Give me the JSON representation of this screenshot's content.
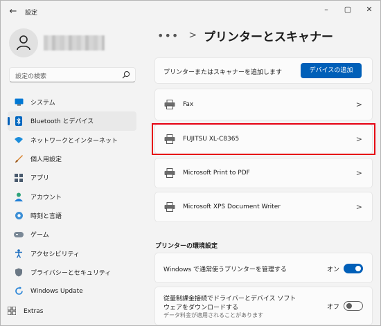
{
  "window": {
    "title": "設定",
    "controls": [
      "minimize",
      "maximize",
      "close"
    ]
  },
  "search": {
    "placeholder": "設定の検索"
  },
  "sidebar": {
    "items": [
      {
        "label": "システム",
        "icon": "system-icon"
      },
      {
        "label": "Bluetooth とデバイス",
        "icon": "bluetooth-icon",
        "active": true
      },
      {
        "label": "ネットワークとインターネット",
        "icon": "network-icon"
      },
      {
        "label": "個人用設定",
        "icon": "personalization-icon"
      },
      {
        "label": "アプリ",
        "icon": "apps-icon"
      },
      {
        "label": "アカウント",
        "icon": "accounts-icon"
      },
      {
        "label": "時刻と言語",
        "icon": "time-language-icon"
      },
      {
        "label": "ゲーム",
        "icon": "gaming-icon"
      },
      {
        "label": "アクセシビリティ",
        "icon": "accessibility-icon"
      },
      {
        "label": "プライバシーとセキュリティ",
        "icon": "privacy-icon"
      },
      {
        "label": "Windows Update",
        "icon": "windows-update-icon"
      }
    ],
    "extras": "Extras"
  },
  "breadcrumb": {
    "dots": "•••",
    "chevron": ">",
    "title": "プリンターとスキャナー"
  },
  "add_card": {
    "label": "プリンターまたはスキャナーを追加します",
    "button": "デバイスの追加"
  },
  "printers": [
    {
      "name": "Fax"
    },
    {
      "name": "FUJITSU XL-C8365",
      "highlighted": true
    },
    {
      "name": "Microsoft Print to PDF"
    },
    {
      "name": "Microsoft XPS Document Writer"
    }
  ],
  "settings_section": {
    "title": "プリンターの環境設定",
    "items": [
      {
        "label": "Windows で通常使うプリンターを管理する",
        "state": "オン",
        "on": true
      },
      {
        "label_line1": "従量制課金接続でドライバーとデバイス ソフト",
        "label_line2": "ウェアをダウンロードする",
        "description": "データ料金が適用されることがあります",
        "state": "オフ",
        "on": false
      }
    ]
  },
  "colors": {
    "accent": "#005fb8",
    "highlight": "#e60012",
    "background": "#f3f3f3",
    "card": "#fbfbfb"
  }
}
